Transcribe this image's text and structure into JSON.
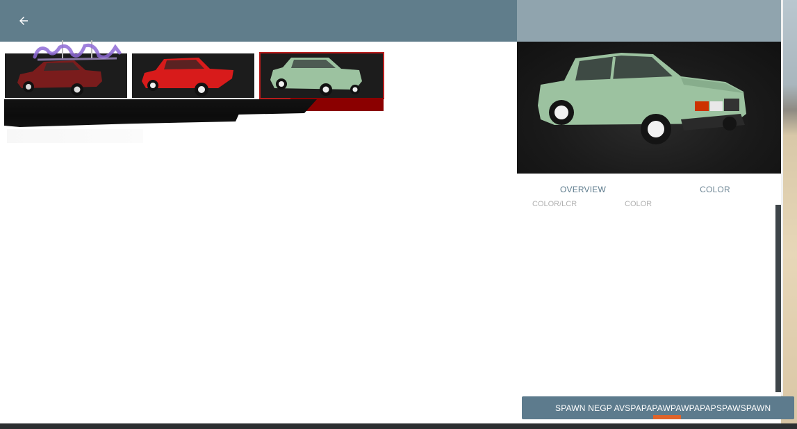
{
  "header": {
    "back_icon": "arrow-left-icon",
    "bar_color": "#607d8b",
    "right_header_color": "#90a4ae"
  },
  "thumbnails": [
    {
      "name": "dark red sedan",
      "color": "#7a1c1c",
      "selected": false
    },
    {
      "name": "red sedan",
      "color": "#d81b1b",
      "selected": false
    },
    {
      "name": "light green sedan",
      "color": "#9cc2a0",
      "selected": true
    }
  ],
  "preview": {
    "car_color": "#9cc2a0",
    "background": "#1a1a1a"
  },
  "tabs": [
    {
      "label": "OVERVIEW",
      "active": true
    },
    {
      "label": "COLOR",
      "active": false
    }
  ],
  "ghost_tabs": [
    "COLOR/LCR",
    "COLOR"
  ],
  "spawn": {
    "label": "SPAWN NEGP  AVSPAPAPAWPAWPAPAPSPAWSPAWN",
    "accent_color": "#e0642a"
  },
  "colors": {
    "accent_red": "#b71c1c",
    "button": "#5d7b8d"
  }
}
